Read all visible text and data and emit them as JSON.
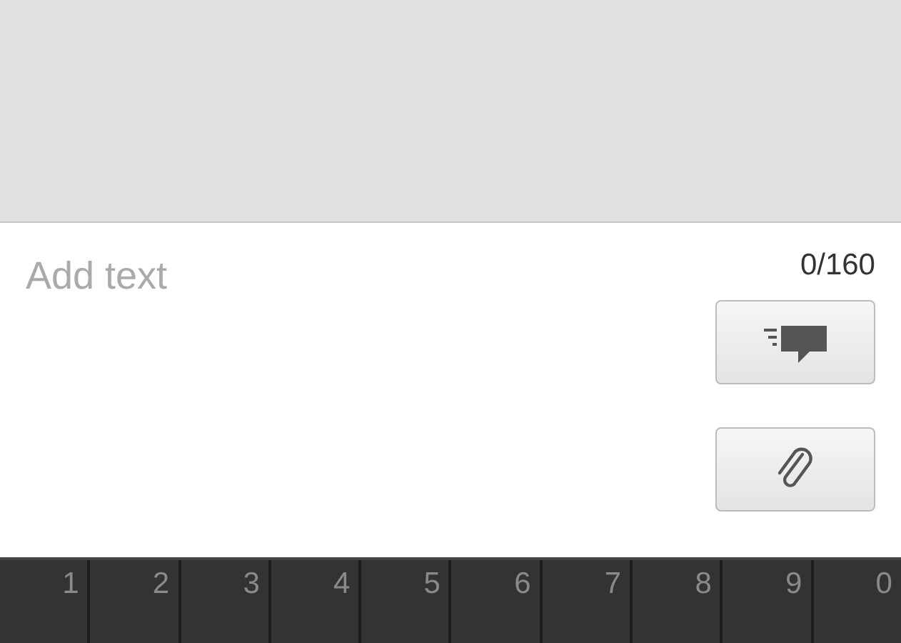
{
  "compose": {
    "placeholder": "Add text",
    "counter": "0/160"
  },
  "buttons": [
    {
      "kind": "send"
    },
    {
      "kind": "attach"
    }
  ],
  "keyboard": {
    "hints": [
      "1",
      "2",
      "3",
      "4",
      "5",
      "6",
      "7",
      "8",
      "9",
      "0"
    ]
  }
}
